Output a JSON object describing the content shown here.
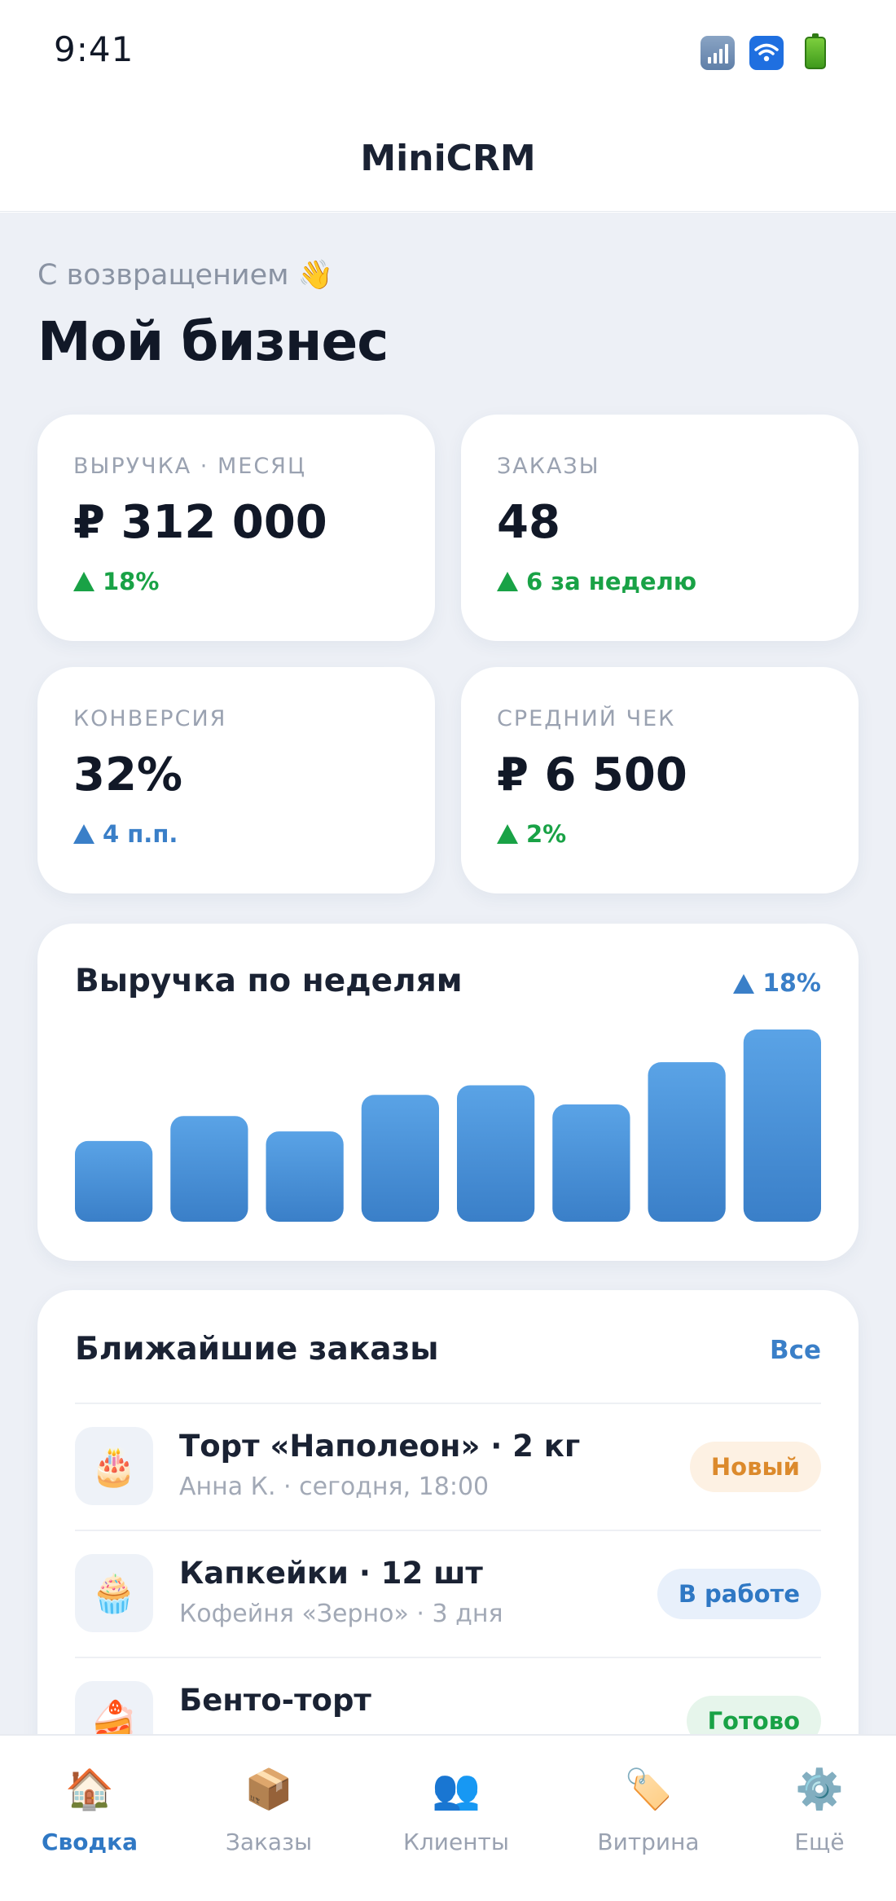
{
  "status_bar": {
    "time": "9:41",
    "icons": [
      "signal-icon",
      "wifi-icon",
      "battery-icon"
    ]
  },
  "header": {
    "title": "MiniCRM"
  },
  "greeting": "С возвращением 👋",
  "page_title": "Мой бизнес",
  "colors": {
    "accent": "#2f78c4",
    "positive": "#19a246",
    "info": "#3a7fc8",
    "background": "#edf0f6"
  },
  "kpis": [
    {
      "label": "ВЫРУЧКА · МЕСЯЦ",
      "value": "₽ 312 000",
      "delta": "18%",
      "trend": "up",
      "color": "#19a246"
    },
    {
      "label": "ЗАКАЗЫ",
      "value": "48",
      "delta": "6 за неделю",
      "trend": "up",
      "color": "#19a246"
    },
    {
      "label": "КОНВЕРСИЯ",
      "value": "32%",
      "delta": "4 п.п.",
      "trend": "up",
      "color": "#3a7fc8"
    },
    {
      "label": "СРЕДНИЙ ЧЕК",
      "value": "₽ 6 500",
      "delta": "2%",
      "trend": "up",
      "color": "#19a246"
    }
  ],
  "chart": {
    "title": "Выручка по неделям",
    "delta": "18%",
    "delta_color": "#3a7fc8",
    "bar_color_top": "#5aa3e6",
    "bar_color_bottom": "#3a7fc8"
  },
  "chart_data": {
    "type": "bar",
    "title": "Выручка по неделям",
    "categories": [],
    "values": [
      42,
      55,
      47,
      66,
      71,
      61,
      83,
      100
    ],
    "ylim": [
      0,
      100
    ],
    "grid": false
  },
  "orders": {
    "title": "Ближайшие заказы",
    "all_label": "Все",
    "items": [
      {
        "icon": "cake-icon",
        "emoji": "🎂",
        "name": "Торт «Наполеон» · 2 кг",
        "meta": "Анна К. · сегодня, 18:00",
        "status": "Новый",
        "status_bg": "#fdf1e3",
        "status_fg": "#dc8a2c"
      },
      {
        "icon": "cupcake-icon",
        "emoji": "🧁",
        "name": "Капкейки · 12 шт",
        "meta": "Кофейня «Зерно» · 3 дня",
        "status": "В работе",
        "status_bg": "#e8f0fb",
        "status_fg": "#2f78c4"
      },
      {
        "icon": "cake-slice-icon",
        "emoji": "🍰",
        "name": "Бенто-торт",
        "meta": "",
        "status": "Готово",
        "status_bg": "#e6f5eb",
        "status_fg": "#19a246"
      }
    ]
  },
  "tabs": [
    {
      "label": "Сводка",
      "icon": "home-icon",
      "emoji": "🏠",
      "active": true
    },
    {
      "label": "Заказы",
      "icon": "package-icon",
      "emoji": "📦",
      "active": false
    },
    {
      "label": "Клиенты",
      "icon": "users-icon",
      "emoji": "👥",
      "active": false
    },
    {
      "label": "Витрина",
      "icon": "tag-icon",
      "emoji": "🏷️",
      "active": false
    },
    {
      "label": "Ещё",
      "icon": "gear-icon",
      "emoji": "⚙️",
      "active": false
    }
  ]
}
